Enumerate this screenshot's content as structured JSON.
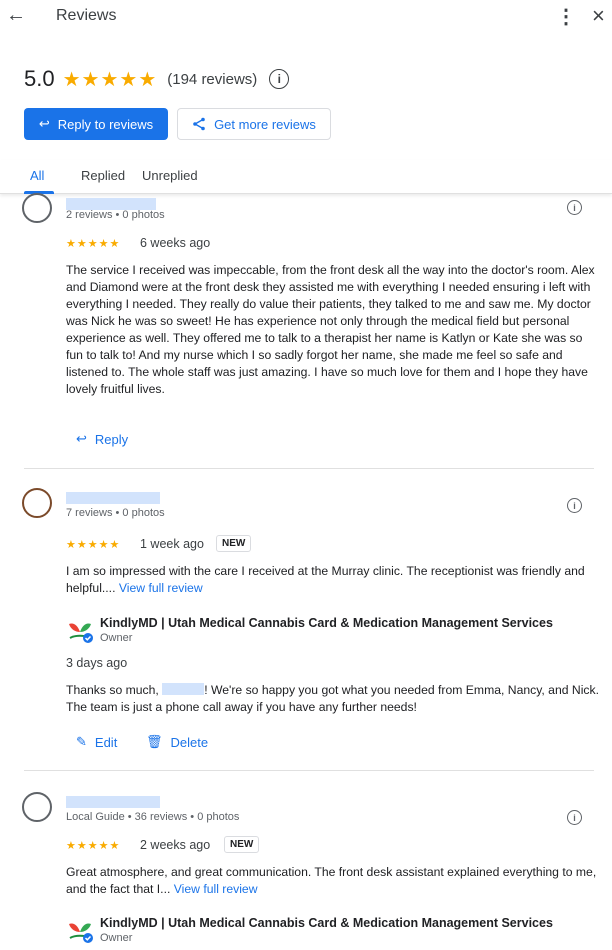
{
  "header": {
    "title": "Reviews",
    "back_icon": "arrow-back-icon",
    "more_icon": "more-vert-icon",
    "close_icon": "close-icon"
  },
  "summary": {
    "rating": "5.0",
    "stars": "★★★★★",
    "count": "(194 reviews)"
  },
  "actions": {
    "reply_label": "Reply to reviews",
    "more_reviews_label": "Get more reviews"
  },
  "tabs": [
    {
      "label": "All",
      "active": true
    },
    {
      "label": "Replied",
      "active": false
    },
    {
      "label": "Unreplied",
      "active": false
    }
  ],
  "reviews": [
    {
      "meta": "2 reviews • 0 photos",
      "stars": "★★★★★",
      "when": "6 weeks ago",
      "text": "The service I received was impeccable, from the front desk all the way into the doctor's room. Alex and Diamond were at the front desk they assisted me with everything I needed ensuring i left with everything I needed. They really do value their patients, they talked to me and saw me. My doctor was Nick he was so sweet! He has experience not only through the medical field but personal experience as well. They offered me to talk to a therapist her name is Katlyn or Kate she was so fun to talk to! And my nurse which I so sadly forgot her name, she made me feel so safe and listened to. The whole staff was just amazing. I have so much love for them and I hope they have lovely fruitful lives.",
      "reply_label": "Reply"
    },
    {
      "meta": "7 reviews • 0 photos",
      "stars": "★★★★★",
      "when": "1 week ago",
      "badge": "NEW",
      "text": "I am so impressed with the care I received at the Murray clinic. The receptionist was friendly and helpful....",
      "view_full": "View full review",
      "owner_name": "KindlyMD | Utah Medical Cannabis Card & Medication Management Services",
      "owner_role": "Owner",
      "reply_when": "3 days ago",
      "reply_text_before": "Thanks so much,",
      "reply_text_after": "! We're so happy you got what you needed from Emma, Nancy, and Nick. The team is just a phone call away if you have any further needs!",
      "edit_label": "Edit",
      "delete_label": "Delete"
    },
    {
      "meta": "Local Guide • 36 reviews • 0 photos",
      "stars": "★★★★★",
      "when": "2 weeks ago",
      "badge": "NEW",
      "text": "Great atmosphere, and great communication. The front desk assistant explained everything to me, and the fact that I...",
      "view_full": "View full review",
      "owner_name": "KindlyMD | Utah Medical Cannabis Card & Medication Management Services",
      "owner_role": "Owner"
    }
  ],
  "colors": {
    "accent": "#1a73e8",
    "star": "#f9ab00",
    "redacted": "#d2e3fc"
  }
}
